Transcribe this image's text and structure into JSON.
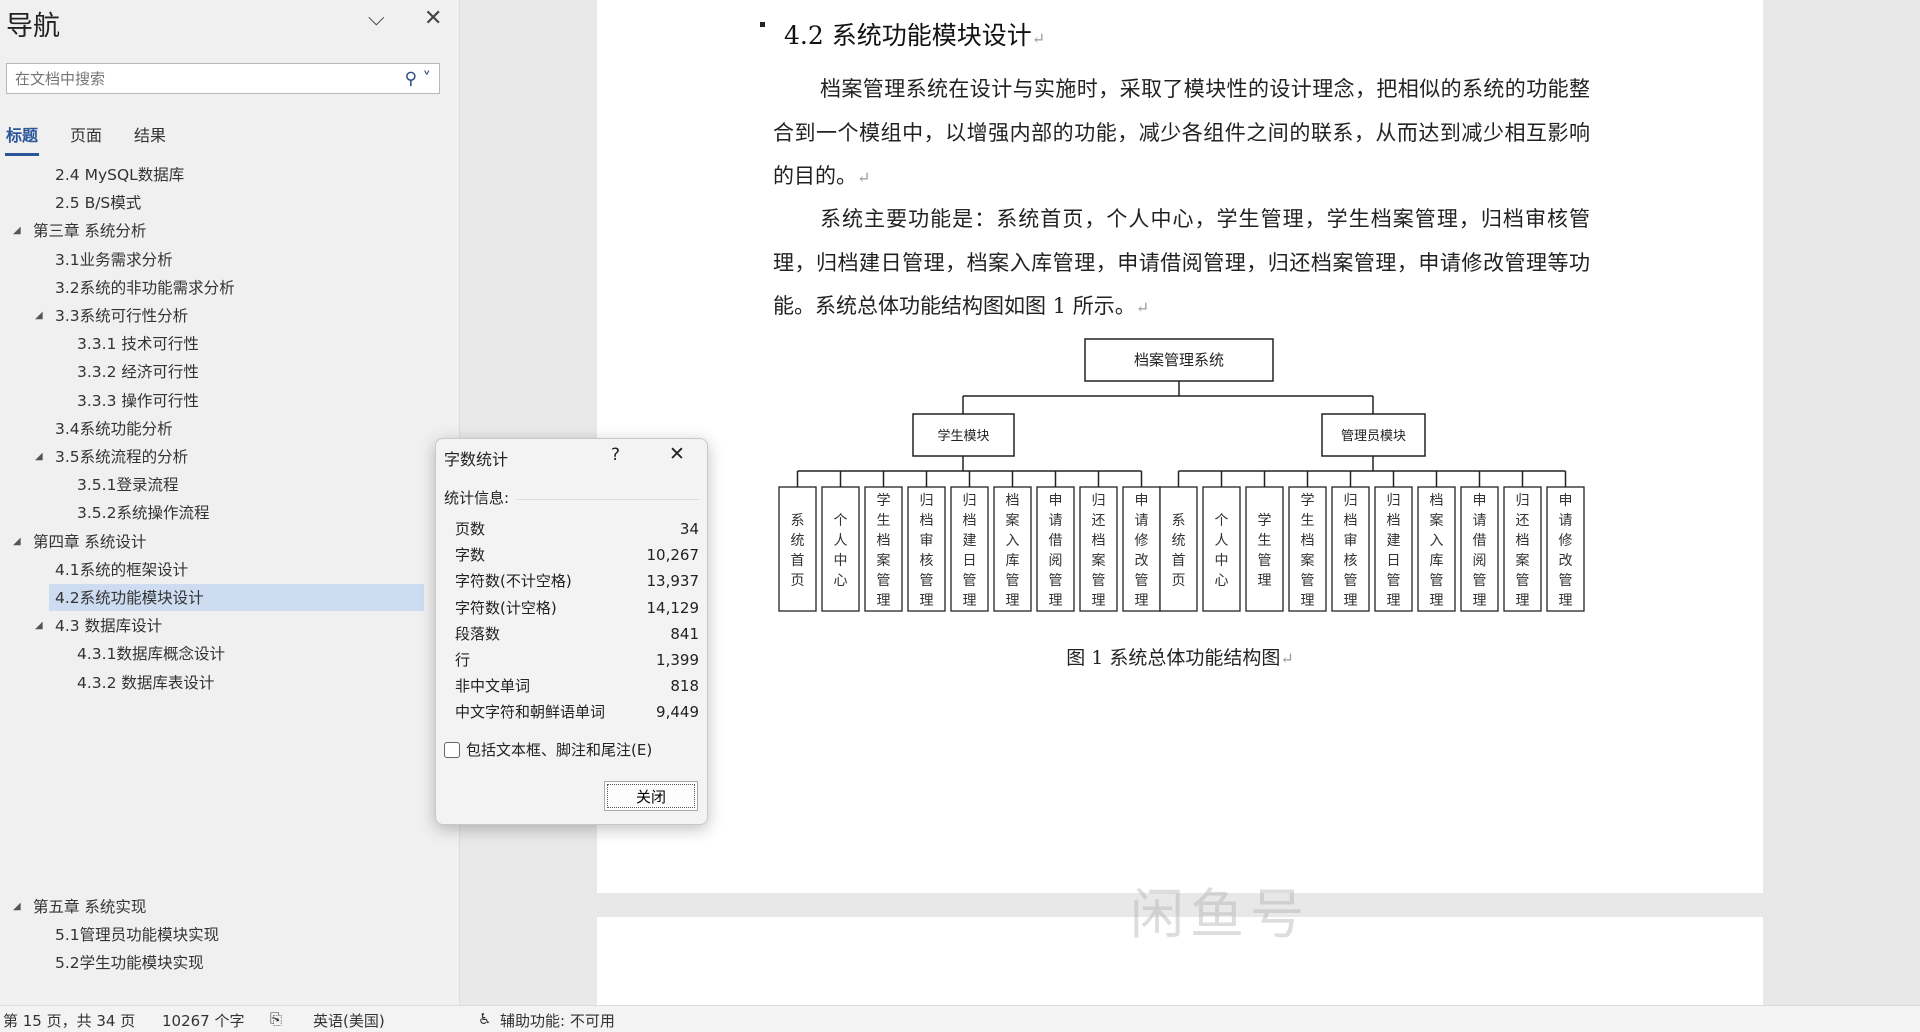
{
  "nav": {
    "title": "导航",
    "search_placeholder": "在文档中搜索",
    "tabs": [
      "标题",
      "页面",
      "结果"
    ],
    "items": [
      {
        "label": "2.4 MySQL数据库",
        "level": 2,
        "exp": false
      },
      {
        "label": "2.5 B/S模式",
        "level": 2,
        "exp": false
      },
      {
        "label": "第三章 系统分析",
        "level": 1,
        "exp": true
      },
      {
        "label": "3.1业务需求分析",
        "level": 2,
        "exp": false
      },
      {
        "label": "3.2系统的非功能需求分析",
        "level": 2,
        "exp": false
      },
      {
        "label": "3.3系统可行性分析",
        "level": 2,
        "exp": true
      },
      {
        "label": "3.3.1 技术可行性",
        "level": 3,
        "exp": false
      },
      {
        "label": "3.3.2 经济可行性",
        "level": 3,
        "exp": false
      },
      {
        "label": "3.3.3 操作可行性",
        "level": 3,
        "exp": false
      },
      {
        "label": "3.4系统功能分析",
        "level": 2,
        "exp": false
      },
      {
        "label": "3.5系统流程的分析",
        "level": 2,
        "exp": true
      },
      {
        "label": "3.5.1登录流程",
        "level": 3,
        "exp": false
      },
      {
        "label": "3.5.2系统操作流程",
        "level": 3,
        "exp": false
      },
      {
        "label": "第四章 系统设计",
        "level": 1,
        "exp": true
      },
      {
        "label": "4.1系统的框架设计",
        "level": 2,
        "exp": false
      },
      {
        "label": "4.2系统功能模块设计",
        "level": 2,
        "exp": false,
        "selected": true
      },
      {
        "label": "4.3 数据库设计",
        "level": 2,
        "exp": true
      },
      {
        "label": "4.3.1数据库概念设计",
        "level": 3,
        "exp": false
      },
      {
        "label": "4.3.2 数据库表设计",
        "level": 3,
        "exp": false
      }
    ],
    "items2": [
      {
        "label": "第五章 系统实现",
        "level": 1,
        "exp": true
      },
      {
        "label": "5.1管理员功能模块实现",
        "level": 2,
        "exp": false
      },
      {
        "label": "5.2学生功能模块实现",
        "level": 2,
        "exp": false
      }
    ]
  },
  "doc": {
    "heading": "4.2 系统功能模块设计",
    "p1": "档案管理系统在设计与实施时，采取了模块性的设计理念，把相似的系统的功能整合到一个模组中，以增强内部的功能，减少各组件之间的联系，从而达到减少相互影响的目的。",
    "p2": "系统主要功能是：系统首页，个人中心，学生管理，学生档案管理，归档审核管理，归档建日管理，档案入库管理，申请借阅管理，归还档案管理，申请修改管理等功能。系统总体功能结构图如图 1 所示。",
    "caption": "图 1  系统总体功能结构图",
    "diagram": {
      "root": "档案管理系统",
      "student": {
        "label": "学生模块",
        "leaves": [
          "系统首页",
          "个人中心",
          "学生档案管理",
          "归档审核管理",
          "归档建日管理",
          "档案入库管理",
          "申请借阅管理",
          "归还档案管理",
          "申请修改管理"
        ]
      },
      "admin": {
        "label": "管理员模块",
        "leaves": [
          "系统首页",
          "个人中心",
          "学生管理",
          "学生档案管理",
          "归档审核管理",
          "归档建日管理",
          "档案入库管理",
          "申请借阅管理",
          "归还档案管理",
          "申请修改管理"
        ]
      }
    },
    "watermark": "闲鱼号"
  },
  "dialog": {
    "title": "字数统计",
    "help": "?",
    "section": "统计信息:",
    "stats": [
      [
        "页数",
        "34"
      ],
      [
        "字数",
        "10,267"
      ],
      [
        "字符数(不计空格)",
        "13,937"
      ],
      [
        "字符数(计空格)",
        "14,129"
      ],
      [
        "段落数",
        "841"
      ],
      [
        "行",
        "1,399"
      ],
      [
        "非中文单词",
        "818"
      ],
      [
        "中文字符和朝鲜语单词",
        "9,449"
      ]
    ],
    "checkbox": "包括文本框、脚注和尾注(E)",
    "checked": false,
    "close": "关闭"
  },
  "status": {
    "page": "第 15 页，共 34 页",
    "words": "10267 个字",
    "lang": "英语(美国)",
    "a11y": "辅助功能: 不可用"
  }
}
